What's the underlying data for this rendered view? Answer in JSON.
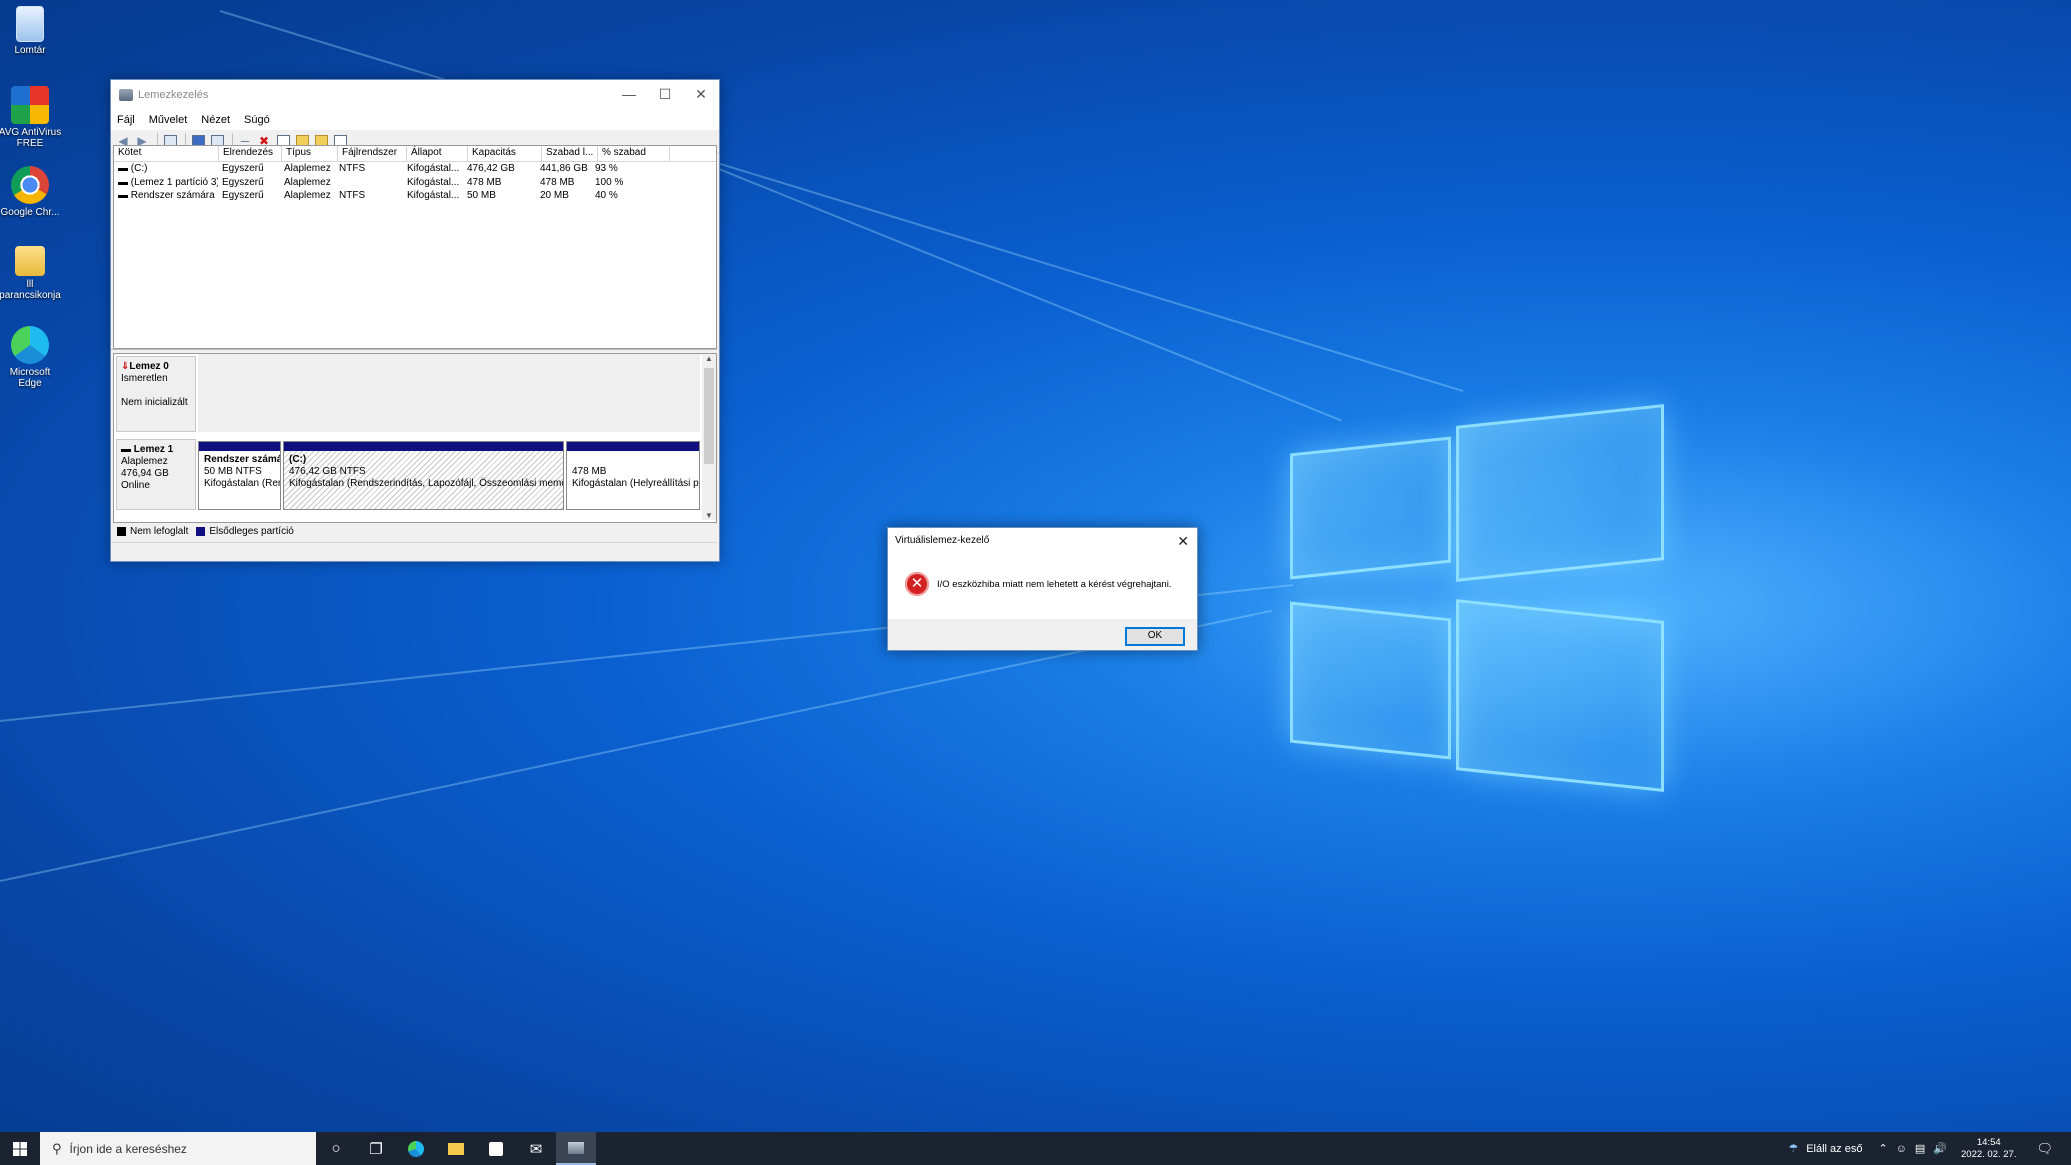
{
  "desktop": {
    "icons": [
      {
        "label": "Lomtár",
        "icon": "recycle-bin-icon"
      },
      {
        "label": "AVG AntiVirus FREE",
        "icon": "avg-icon"
      },
      {
        "label": "Google Chr...",
        "icon": "chrome-icon"
      },
      {
        "label": "lll parancsikonja",
        "icon": "folder-shortcut-icon"
      },
      {
        "label": "Microsoft Edge",
        "icon": "edge-icon"
      }
    ]
  },
  "diskmgmt": {
    "title": "Lemezkezelés",
    "menu": [
      "Fájl",
      "Művelet",
      "Nézet",
      "Súgó"
    ],
    "columns": [
      "Kötet",
      "Elrendezés",
      "Típus",
      "Fájlrendszer",
      "Állapot",
      "Kapacitás",
      "Szabad l...",
      "% szabad"
    ],
    "rows": [
      [
        "(C:)",
        "Egyszerű",
        "Alaplemez",
        "NTFS",
        "Kifogástal...",
        "476,42 GB",
        "441,86 GB",
        "93 %"
      ],
      [
        "(Lemez 1 partíció 3)",
        "Egyszerű",
        "Alaplemez",
        "",
        "Kifogástal...",
        "478 MB",
        "478 MB",
        "100 %"
      ],
      [
        "Rendszer számára ...",
        "Egyszerű",
        "Alaplemez",
        "NTFS",
        "Kifogástal...",
        "50 MB",
        "20 MB",
        "40 %"
      ]
    ],
    "disk0": {
      "name": "Lemez 0",
      "type": "Ismeretlen",
      "status": "Nem inicializált"
    },
    "disk1": {
      "name": "Lemez 1",
      "type": "Alaplemez",
      "size": "476,94 GB",
      "status": "Online"
    },
    "partitions": [
      {
        "title": "Rendszer számá",
        "size": "50 MB NTFS",
        "state": "Kifogástalan (Rer"
      },
      {
        "title": "(C:)",
        "size": "476,42 GB NTFS",
        "state": "Kifogástalan (Rendszerindítás, Lapozófájl, Összeomlási memória"
      },
      {
        "title": "",
        "size": "478 MB",
        "state": "Kifogástalan (Helyreállítási pa"
      }
    ],
    "legend": {
      "unallocated": "Nem lefoglalt",
      "primary": "Elsődleges partíció"
    }
  },
  "dialog": {
    "title": "Virtuálislemez-kezelő",
    "message": "I/O eszközhiba miatt nem lehetett a kérést végrehajtani.",
    "ok": "OK"
  },
  "taskbar": {
    "search_placeholder": "Írjon ide a kereséshez",
    "weather": "Eláll az eső",
    "time": "14:54",
    "date": "2022. 02. 27."
  },
  "colors": {
    "accent": "#0078d7",
    "partition_bar": "#0f0f7f",
    "error": "#d32121"
  }
}
